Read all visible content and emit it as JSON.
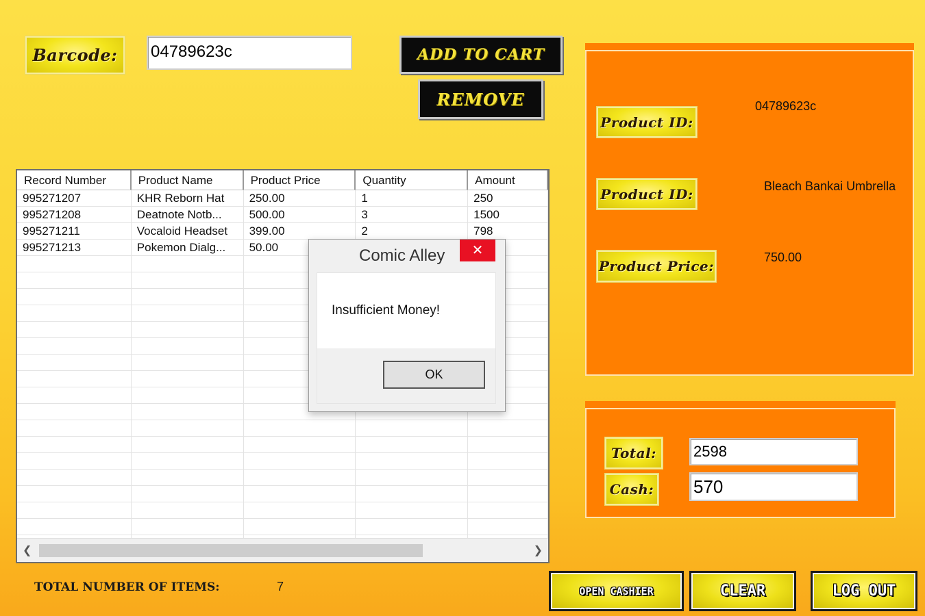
{
  "app": {
    "dialog_title": "Comic Alley"
  },
  "barcode": {
    "label": "Barcode:",
    "value": "04789623c"
  },
  "buttons": {
    "add_to_cart": "ADD TO CART",
    "remove": "REMOVE",
    "open_cashier": "OPEN CASHIER",
    "clear": "CLEAR",
    "log_out": "LOG OUT"
  },
  "grid": {
    "columns": [
      "Record Number",
      "Product Name",
      "Product  Price",
      "Quantity",
      "Amount"
    ],
    "rows": [
      [
        "995271207",
        "KHR Reborn Hat",
        "250.00",
        "1",
        "250"
      ],
      [
        "995271208",
        "Deatnote Notb...",
        "500.00",
        "3",
        "1500"
      ],
      [
        "995271211",
        "Vocaloid Headset",
        "399.00",
        "2",
        "798"
      ],
      [
        "995271213",
        "Pokemon Dialg...",
        "50.00",
        "",
        ""
      ]
    ]
  },
  "product_panel": {
    "id_label": "Product ID:",
    "id_value": "04789623c",
    "name_label": "Product ID:",
    "name_value": "Bleach Bankai Umbrella",
    "price_label": "Product Price:",
    "price_value": "750.00"
  },
  "totals": {
    "total_label": "Total:",
    "total_value": "2598",
    "cash_label": "Cash:",
    "cash_value": "570"
  },
  "footer": {
    "items_label": "TOTAL NUMBER OF ITEMS:",
    "items_value": "7"
  },
  "dialog": {
    "title": "Comic Alley",
    "message": "Insufficient Money!",
    "ok": "OK",
    "close_icon": "close-icon"
  },
  "colors": {
    "panel": "#ff7f00",
    "accent_yellow": "#f4e23a",
    "close_red": "#e81123"
  }
}
